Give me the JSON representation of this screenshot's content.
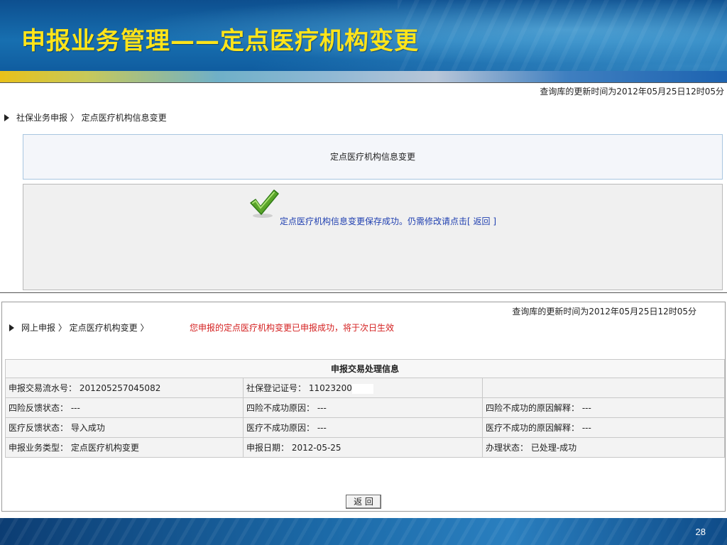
{
  "slide": {
    "title": "申报业务管理——定点医疗机构变更",
    "page_number": "28"
  },
  "screen1": {
    "update_time": "查询库的更新时间为2012年05月25日12时05分",
    "breadcrumb": "社保业务申报 〉 定点医疗机构信息变更",
    "panel_title": "定点医疗机构信息变更",
    "success_message": "定点医疗机构信息变更保存成功。仍需修改请点击[ 返回 ]"
  },
  "screen2": {
    "update_time": "查询库的更新时间为2012年05月25日12时05分",
    "breadcrumb": "网上申报 〉 定点医疗机构变更 〉",
    "notice": "您申报的定点医疗机构变更已申报成功，将于次日生效",
    "table_title": "申报交易处理信息",
    "rows": [
      [
        "申报交易流水号：  201205257045082",
        "社保登记证号：  11023200",
        ""
      ],
      [
        "四险反馈状态：  ---",
        "四险不成功原因：  ---",
        "四险不成功的原因解释：  ---"
      ],
      [
        "医疗反馈状态：  导入成功",
        "医疗不成功原因：  ---",
        "医疗不成功的原因解释：  ---"
      ],
      [
        "申报业务类型：  定点医疗机构变更",
        "申报日期：  2012-05-25",
        "办理状态：  已处理-成功"
      ]
    ],
    "back_button": "返  回"
  },
  "colors": {
    "title": "#ffe41a",
    "notice": "#d42020",
    "success_link": "#1f3fb0"
  }
}
